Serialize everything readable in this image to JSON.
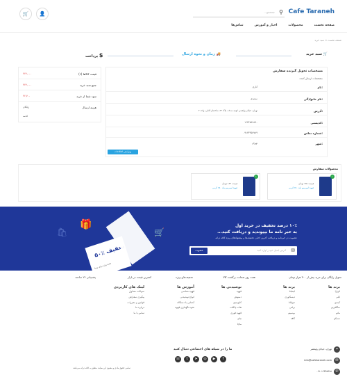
{
  "header": {
    "logo": "Cafe Taraneh",
    "search_placeholder": "جستجو...",
    "nav": [
      "صفحه نخست",
      "محصولات",
      "اخبار و آموزش",
      "تماس‌ها"
    ]
  },
  "breadcrumb": "صفحه نخست > سبد خرید",
  "steps": {
    "cart": "سبد خرید",
    "shipping": "زمان و نحوه ارسال",
    "payment": "پرداخت"
  },
  "shipping_info": {
    "title": "مشخصات تحویل گیرنده سفارش",
    "subtitle": "مشخصات ارسال کننده",
    "rows": [
      {
        "label": "نام:",
        "value": "آناری"
      },
      {
        "label": "نام خانوادگی:",
        "value": "سعیدی"
      },
      {
        "label": "آدرس:",
        "value": "تهران، خیابان ولیعصر، کوچه صدف، پلاک ۲۳، ساختمان آقایی، واحد ۴"
      },
      {
        "label": "کدپستی:",
        "value": "۱۲۳۴۵۶۷۸۹۰"
      },
      {
        "label": "شماره تماس:",
        "value": "۰۹۱۲۳۴۵۶۷۸۹"
      },
      {
        "label": "شهر:",
        "value": "تهران"
      }
    ],
    "edit_button": "ویرایش اطلاعات"
  },
  "summary": {
    "rows": [
      {
        "label": "قیمت کالاها (۲)",
        "value": "۲۶۷,۰۰۰"
      },
      {
        "label": "جمع سبد خرید",
        "value": "۲۶۷,۰۰۰"
      },
      {
        "label": "سود شما از خرید",
        "value": "۲۶,۷۰۰"
      },
      {
        "label": "هزینه ارسال",
        "value": "رایگان"
      }
    ],
    "note": "ادامه"
  },
  "order_items": {
    "title": "محصولات سفارش",
    "items": [
      {
        "name": "قهوه اسپرسو بلند ۲۵۰ گرمی",
        "price": "قیمت: ۱۳۵ تومان",
        "badge": "۱"
      },
      {
        "name": "قهوه اسپرسو بلند ۲۵۰ گرمی",
        "price": "قیمت: ۱۳۲ تومان",
        "badge": "۱"
      }
    ]
  },
  "newsletter": {
    "line1": "۱۰٪ درصد تخفیف در خرید اول",
    "line2": "به خبر نامه ما بپیوندید و دریافت کنید...",
    "desc": "عضویت در خبرنامه و دریافت آخرین اخبار، تخفیف‌ها و پیشنهادهای ویژه کافه ترانه",
    "placeholder": "آدرس ایمیل خود را وارد کنید",
    "button": "عضویت",
    "coupon_text": "۵۰٪ تخفیف",
    "coupon_sub": "هدیه ویژه برای شما"
  },
  "features": [
    "تحویل رایگان برای خرید بیش از ۳۰۰ هزار تومان",
    "هفت روز ضمانت برگشت کالا",
    "تخفیف‌های ویژه",
    "کمترین قیمت در بازار",
    "پشتیبانی ۲۴ ساعته"
  ],
  "footer": {
    "columns": [
      {
        "title": "برند ها",
        "items": [
          "لاوازا",
          "ایلی",
          "کیمبو",
          "سگافردو",
          "ماتو",
          "سمکو"
        ]
      },
      {
        "title": "برند ها",
        "items": [
          "اینجاتا",
          "دیسکاوری",
          "جولیانا",
          "برلنی",
          "بوسینو",
          "کافه"
        ]
      },
      {
        "title": "نوشیدنی ها",
        "items": [
          "قهوه",
          "دمنوش",
          "کاپوچینو",
          "هات چاکلت",
          "قهوه فوری",
          "چای",
          "ماچا"
        ]
      },
      {
        "title": "آموزش ها",
        "items": [
          "قهوه شناسی",
          "انواع نوشیدنی",
          "آشنایی با دستگاه",
          "نحوه نگهداری قهوه"
        ]
      },
      {
        "title": "لینک های کاربردی",
        "items": [
          "سوالات متداول",
          "پیگیری سفارش",
          "قوانین و مقررات",
          "درباره ما",
          "تماس با ما"
        ]
      }
    ],
    "social_title": "ما را در شبکه های اجتماعی دنبال کنید",
    "contact": [
      "تهران، خیابان ولیعصر",
      "info@cafetaraneh.com",
      "۰۲۱-۱۲۳۴۵۶۷۸"
    ],
    "copyright": "تمامی حقوق مادی و معنوی این سایت متعلق به کافه ترانه می‌باشد"
  }
}
